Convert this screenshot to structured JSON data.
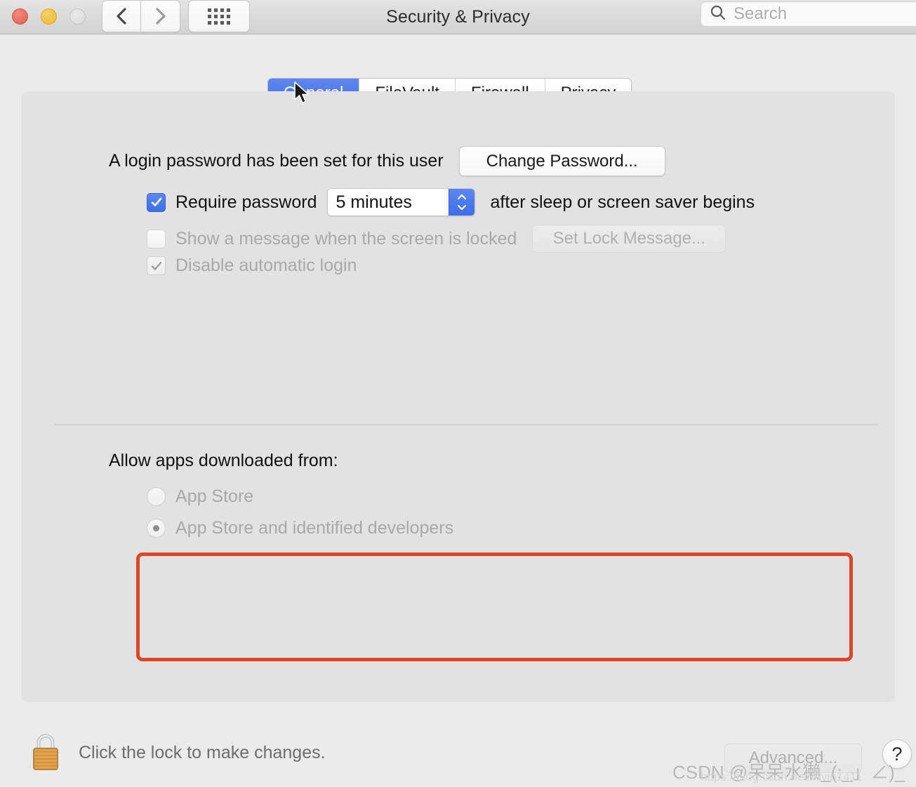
{
  "window": {
    "title": "Security & Privacy",
    "traffic_lights": [
      {
        "name": "close",
        "color": "#e4604f"
      },
      {
        "name": "minimize",
        "color": "#efb92f"
      },
      {
        "name": "zoom",
        "color": "#dcdcdc"
      }
    ],
    "nav": {
      "back_icon": "chevron-left-icon",
      "forward_icon": "chevron-right-icon",
      "grid_icon": "show-all-grid-icon"
    },
    "search": {
      "placeholder": "Search",
      "value": "",
      "icon": "search-icon"
    }
  },
  "tabs": [
    {
      "label": "General",
      "active": true
    },
    {
      "label": "FileVault",
      "active": false
    },
    {
      "label": "Firewall",
      "active": false
    },
    {
      "label": "Privacy",
      "active": false
    }
  ],
  "general": {
    "password_status": "A login password has been set for this user",
    "change_password_button": "Change Password...",
    "require_password": {
      "checked": true,
      "label_before": "Require password",
      "value": "5 minutes",
      "label_after": "after sleep or screen saver begins",
      "stepper_icon": "stepper-up-down-icon"
    },
    "show_message": {
      "checked": false,
      "enabled": false,
      "label": "Show a message when the screen is locked",
      "button": "Set Lock Message..."
    },
    "disable_auto_login": {
      "checked": true,
      "enabled": false,
      "label": "Disable automatic login"
    },
    "allow_apps": {
      "heading": "Allow apps downloaded from:",
      "options": [
        {
          "label": "App Store",
          "selected": false,
          "enabled": false
        },
        {
          "label": "App Store and identified developers",
          "selected": true,
          "enabled": false
        }
      ]
    }
  },
  "footer": {
    "lock_icon": "padlock-closed-icon",
    "lock_text": "Click the lock to make changes.",
    "advanced_button": "Advanced...",
    "help_button": "?"
  },
  "watermark": {
    "text": "CSDN @呆呆水獭_(:_」∠)_",
    "sub": "https://blog.csdn.net/Alvin1411"
  },
  "colors": {
    "accent_blue": "#3f6fe8",
    "annotation_red": "#e0452b",
    "panel_bg": "#e2e2e2",
    "window_bg": "#ebebeb"
  },
  "cursor": {
    "icon": "arrow-cursor-icon"
  }
}
